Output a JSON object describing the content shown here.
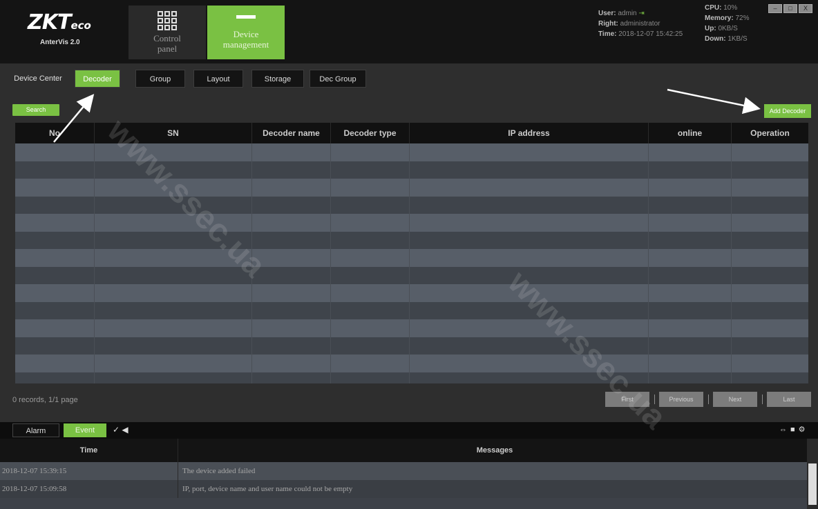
{
  "app": {
    "logo": {
      "brand": "ZKT",
      "brand_suffix": "eco",
      "product": "AnterVis 2.0"
    },
    "nav": {
      "control_panel": "Control panel",
      "device_management": "Device management"
    },
    "status": {
      "user_label": "User:",
      "user": "admin",
      "right_label": "Right:",
      "right": "administrator",
      "time_label": "Time:",
      "time": "2018-12-07 15:42:25",
      "cpu_label": "CPU:",
      "cpu": "10%",
      "memory_label": "Memory:",
      "memory": "72%",
      "up_label": "Up:",
      "up": "0KB/S",
      "down_label": "Down:",
      "down": "1KB/S"
    },
    "window_controls": [
      "–",
      "□",
      "X"
    ]
  },
  "subtabs": [
    "Device Center",
    "Decoder",
    "Group",
    "Layout",
    "Storage",
    "Dec Group"
  ],
  "toolbar": {
    "search_label": "Search",
    "add_label": "Add Decoder"
  },
  "table": {
    "columns": [
      "No",
      "SN",
      "Decoder name",
      "Decoder type",
      "IP address",
      "online",
      "Operation"
    ],
    "rows": []
  },
  "pagination": {
    "records": "0 records, 1/1 page",
    "first": "First",
    "previous": "Previous",
    "next": "Next",
    "last": "Last"
  },
  "events": {
    "tabs": [
      "Alarm",
      "Event"
    ],
    "columns": [
      "Time",
      "Messages"
    ],
    "rows": [
      {
        "time": "2018-12-07 15:39:15",
        "message": "The device added failed"
      },
      {
        "time": "2018-12-07 15:09:58",
        "message": "IP, port, device name and user name could not be empty"
      }
    ]
  },
  "watermark": "www.ssec.ua",
  "colors": {
    "accent": "#7ac143",
    "header_bg": "#141414",
    "panel_bg": "#2e2e2e"
  },
  "icons": [
    "control-panel-grid-icon",
    "device-management-icon",
    "logout-icon",
    "pin-icon",
    "speaker-icon"
  ]
}
